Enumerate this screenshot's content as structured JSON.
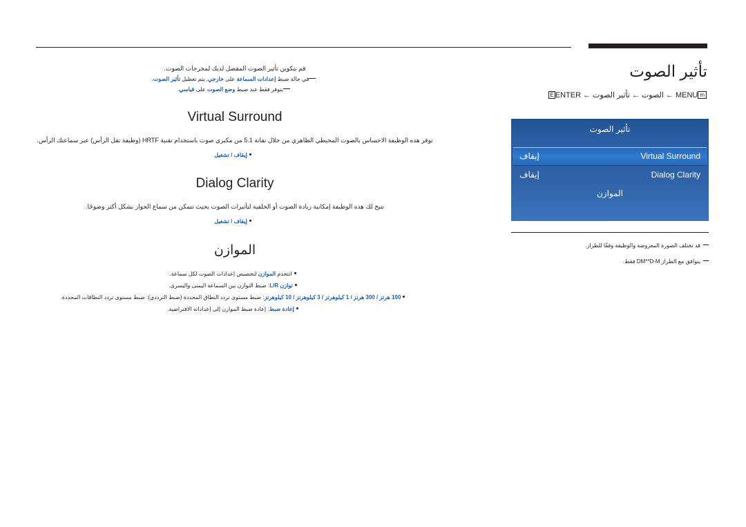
{
  "header": {
    "title": "تأثير الصوت",
    "breadcrumb": {
      "menu_key": "MENU",
      "arrow": "←",
      "seg1": "الصوت",
      "seg2": "تأثير الصوت",
      "enter": "ENTER",
      "enter_key_glyph": "↵"
    }
  },
  "intro": {
    "line1": "قم بتكوين تأثير الصوت المفضل لديك لمخرجات الصوت.",
    "line2_pre": "في حالة ضبط",
    "line2_b1": "إعدادات السماعة",
    "line2_mid": "على",
    "line2_b2": "خارجي",
    "line2_post": ", يتم تعطيل",
    "line2_b3": "تأثير الصوت",
    "line2_end": ".",
    "line3_pre": "يتوفر فقط عند ضبط",
    "line3_b1": "وضع الصوت",
    "line3_mid": "على",
    "line3_b2": "قياسي",
    "line3_end": "."
  },
  "sections": [
    {
      "id": "virtual-surround",
      "title": "Virtual Surround",
      "rtl": false,
      "body": "توفر هذه الوظيفة الاحساس بالصوت المحيطي الظاهري من خلال نقاتة 5.1 من مكبري صوت باستخدام تقنية HRTF (وظيفة نقل الرأس) عبر سماعتك الرأس.",
      "bullets": [
        {
          "text": "إيقاف / تشغيل",
          "highlight": true
        }
      ]
    },
    {
      "id": "dialog-clarity",
      "title": "Dialog Clarity",
      "rtl": false,
      "body": "تتيح لك هذه الوظيفة إمكانية زيادة الصوت أو الخلفية لتأثيرات الصوت بحيث تتمكن من سماع الحوار بشكل أكثر وضوحًا.",
      "bullets": [
        {
          "text": "إيقاف / تشغيل",
          "highlight": true
        }
      ]
    },
    {
      "id": "balance",
      "title": "الموازن",
      "rtl": true,
      "body": "",
      "bullets": [
        {
          "text_pre": "انتخدم ",
          "text_hl": "الموازن",
          "text_post": " لتخصيص إعدادات الصوت لكل سماعة."
        },
        {
          "text_pre": "",
          "text_hl": "توازن L/R",
          "text_post": ": ضبط التوازن بين السماعة اليمنى واليسرى."
        },
        {
          "text_pre": "",
          "text_hl": "100 هرتز / 300 هرتز / 1 كيلوهرتز / 3 كيلوهرتز / 10 كيلوهرتز",
          "text_post": ": ضبط مستوى تردد النطاق المحددة (ضبط الترددي): ضبط مستوى تردد النطاقات المحددة."
        },
        {
          "text_pre": "",
          "text_hl": "إعادة ضبط",
          "text_post": ": إعادة ضبط الموازن إلى إعداداته الافتراضية."
        }
      ]
    }
  ],
  "osd": {
    "title": "تأثير الصوت",
    "rows": [
      {
        "label": "إيقاف",
        "value": "Virtual Surround",
        "selected": true
      },
      {
        "label": "إيقاف",
        "value": "Dialog Clarity",
        "selected": false
      },
      {
        "label": "",
        "value": "الموازن",
        "selected": false,
        "centered": true
      }
    ]
  },
  "notes": [
    "قد تختلف الصورة المعروضة والوظيفة وفقًا للطراز.",
    "يتوافق مع الطراز DM**D-M فقط."
  ]
}
